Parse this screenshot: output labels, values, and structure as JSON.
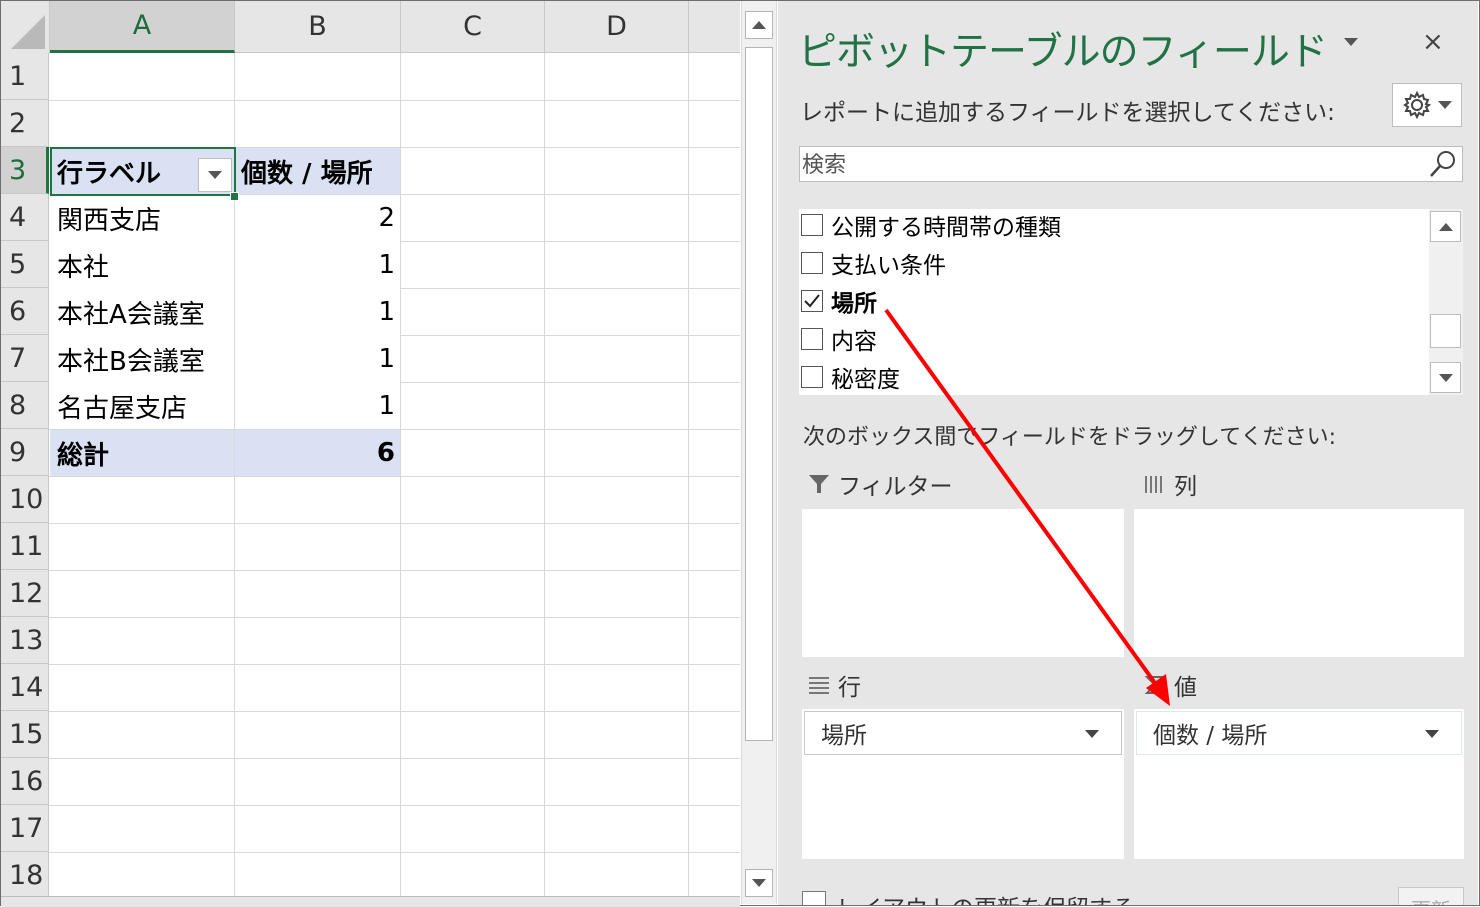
{
  "sheet": {
    "columns": [
      "A",
      "B",
      "C",
      "D"
    ],
    "rows": [
      "1",
      "2",
      "3",
      "4",
      "5",
      "6",
      "7",
      "8",
      "9",
      "10",
      "11",
      "12",
      "13",
      "14",
      "15",
      "16",
      "17",
      "18"
    ],
    "pivot": {
      "header_label": "行ラベル",
      "header_value": "個数 / 場所",
      "rows": [
        {
          "label": "関西支店",
          "value": "2"
        },
        {
          "label": "本社",
          "value": "1"
        },
        {
          "label": "本社A会議室",
          "value": "1"
        },
        {
          "label": "本社B会議室",
          "value": "1"
        },
        {
          "label": "名古屋支店",
          "value": "1"
        }
      ],
      "total_label": "総計",
      "total_value": "6"
    },
    "active_cell": "A3"
  },
  "pane": {
    "title": "ピボットテーブルのフィールド",
    "close_glyph": "×",
    "subtitle": "レポートに追加するフィールドを選択してください:",
    "search_placeholder": "検索",
    "fields": [
      {
        "label": "公開する時間帯の種類",
        "checked": false
      },
      {
        "label": "支払い条件",
        "checked": false
      },
      {
        "label": "場所",
        "checked": true
      },
      {
        "label": "内容",
        "checked": false
      },
      {
        "label": "秘密度",
        "checked": false
      }
    ],
    "drag_label": "次のボックス間でフィールドをドラッグしてください:",
    "areas": {
      "filter": {
        "label": "フィルター",
        "icon": "filter-icon"
      },
      "columns": {
        "label": "列",
        "icon": "columns-icon"
      },
      "rows": {
        "label": "行",
        "icon": "rows-icon",
        "item": "場所"
      },
      "values": {
        "label": "値",
        "icon": "sigma-icon",
        "item": "個数 / 場所"
      }
    },
    "defer_label": "レイアウトの更新を保留する",
    "update_label": "更新"
  },
  "colors": {
    "accent_green": "#217346",
    "pivot_header_blue": "#d9e1f2",
    "arrow_red": "#ff0000"
  }
}
